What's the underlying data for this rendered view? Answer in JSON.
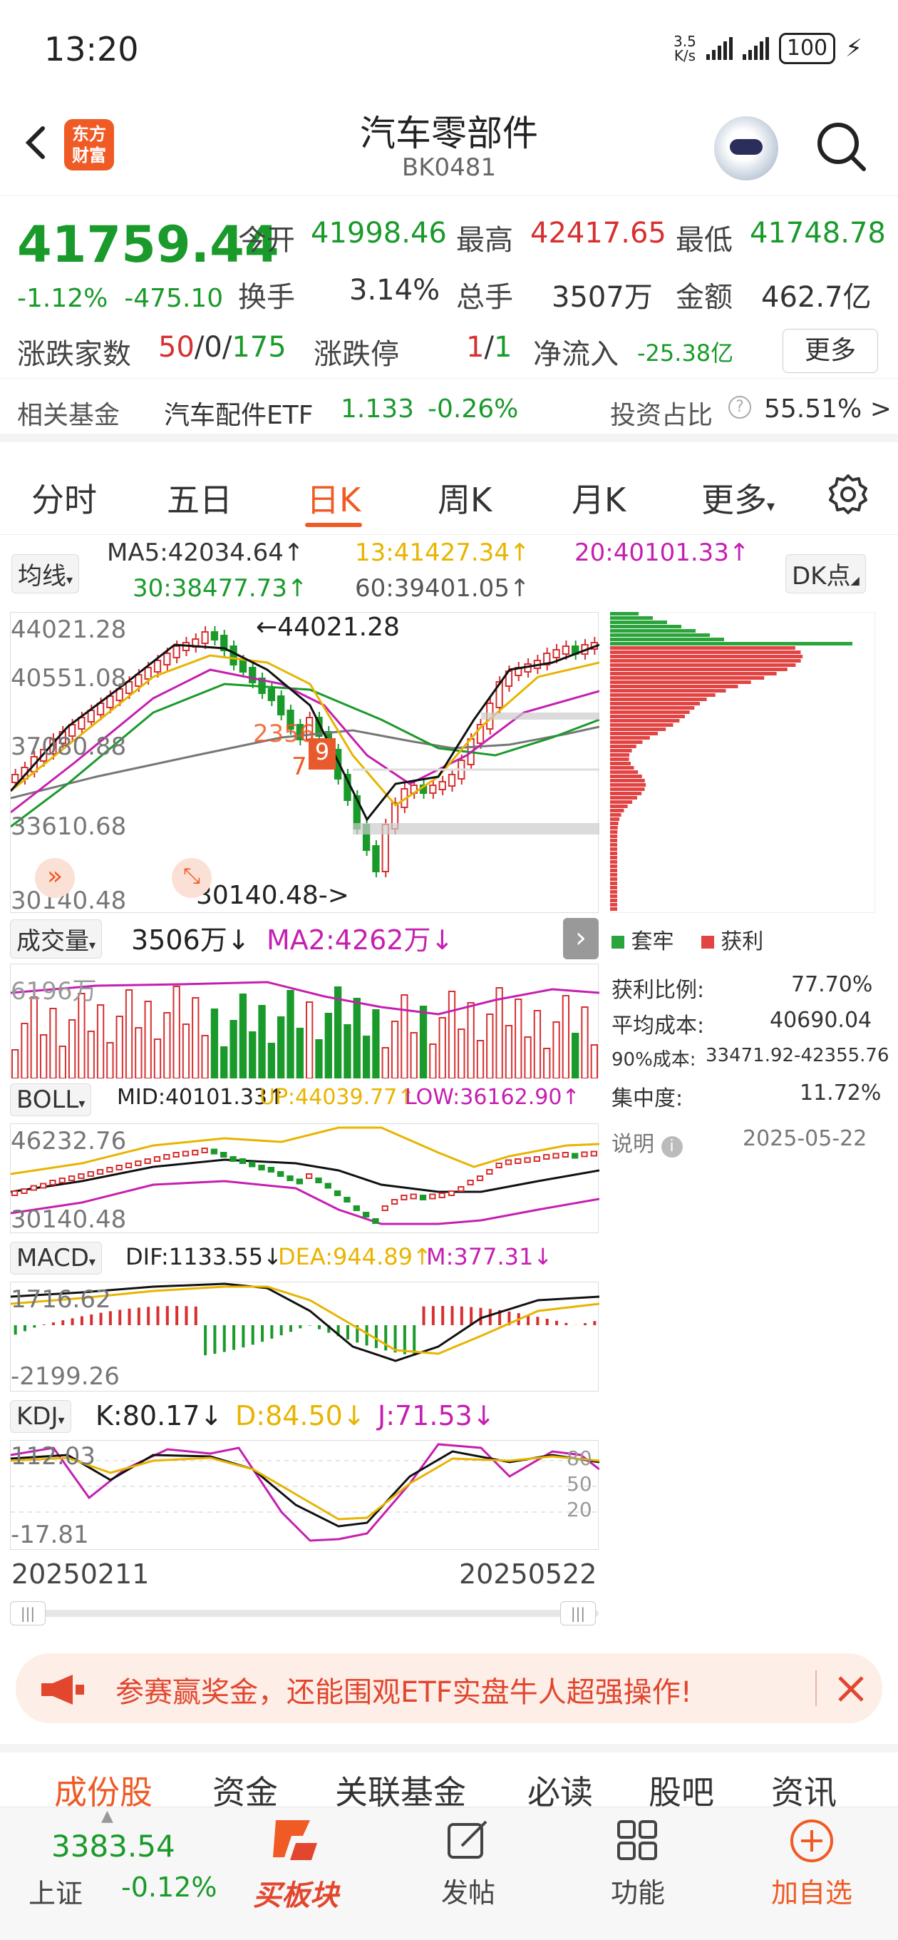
{
  "status_bar": {
    "time": "13:20",
    "net_speed_top": "3.5",
    "net_speed_bottom": "K/s",
    "battery": "100"
  },
  "header": {
    "logo_line1": "东方",
    "logo_line2": "财富",
    "title": "汽车零部件",
    "code": "BK0481"
  },
  "quote": {
    "price": "41759.44",
    "change_pct": "-1.12%",
    "change": "-475.10",
    "open_label": "今开",
    "open": "41998.46",
    "high_label": "最高",
    "high": "42417.65",
    "low_label": "最低",
    "low": "41748.78",
    "turnover_label": "换手",
    "turnover": "3.14%",
    "volume_label": "总手",
    "volume": "3507万",
    "amount_label": "金额",
    "amount": "462.7亿",
    "updown_label": "涨跌家数",
    "up": "50",
    "flat": "0",
    "down": "175",
    "sep": "/",
    "limit_label": "涨跌停",
    "limit_up": "1",
    "limit_down": "1",
    "netflow_label": "净流入",
    "netflow": "-25.38亿",
    "more_label": "更多"
  },
  "fund_row": {
    "label": "相关基金",
    "fund_name": "汽车配件ETF",
    "fund_price": "1.133",
    "fund_change": "-0.26%",
    "ratio_label": "投资占比",
    "ratio_value": "55.51% >"
  },
  "tabs": {
    "t1": "分时",
    "t2": "五日",
    "t3": "日K",
    "t4": "周K",
    "t5": "月K",
    "t6": "更多",
    "active": "日K"
  },
  "chart": {
    "ma_dropdown": "均线",
    "ma5": "MA5:42034.64↑",
    "ma13": "13:41427.34↑",
    "ma20": "20:40101.33↑",
    "ma30": "30:38477.73↑",
    "ma60": "60:39401.05↑",
    "dk_button": "DK点",
    "y_ticks": [
      "44021.28",
      "40551.08",
      "37080.88",
      "33610.68",
      "30140.48"
    ],
    "max_label": "←44021.28",
    "min_label": "30140.48->",
    "vol_dropdown": "成交量",
    "vol_value": "3506万↓",
    "vol_ma2": "MA2:4262万↓",
    "vol_tick": "6196万",
    "boll_dropdown": "BOLL",
    "boll_mid": "MID:40101.33↑",
    "boll_up": "UP:44039.77↑",
    "boll_low": "LOW:36162.90↑",
    "boll_ticks": [
      "46232.76",
      "30140.48"
    ],
    "macd_dropdown": "MACD",
    "macd_dif": "DIF:1133.55↓",
    "macd_dea": "DEA:944.89↑",
    "macd_m": "M:377.31↓",
    "macd_ticks": [
      "1716.62",
      "-2199.26"
    ],
    "kdj_dropdown": "KDJ",
    "kdj_k": "K:80.17↓",
    "kdj_d": "D:84.50↓",
    "kdj_j": "J:71.53↓",
    "kdj_ticks": [
      "112.03",
      "-17.81"
    ],
    "kdj_levels": [
      "80",
      "50",
      "20"
    ],
    "date_start": "20250211",
    "date_end": "20250522",
    "signal_labels": [
      "2",
      "3",
      "5",
      "6",
      "7",
      "9"
    ]
  },
  "chip_panel": {
    "legend_trapped": "套牢",
    "legend_profit": "获利",
    "profit_ratio_label": "获利比例:",
    "profit_ratio": "77.70%",
    "avg_cost_label": "平均成本:",
    "avg_cost": "40690.04",
    "cost90_label": "90%成本:",
    "cost90": "33471.92-42355.76",
    "concentration_label": "集中度:",
    "concentration": "11.72%",
    "note_label": "说明",
    "date": "2025-05-22"
  },
  "banner": {
    "text": "参赛赢奖金，还能围观ETF实盘牛人超强操作!"
  },
  "bottom_tabs": {
    "b1": "成份股",
    "b2": "资金",
    "b3": "关联基金",
    "b4": "必读",
    "b5": "股吧",
    "b6": "资讯"
  },
  "bottom_bar": {
    "index_value": "3383.54",
    "index_name": "上证",
    "index_change": "-0.12%",
    "buy_label": "买板块",
    "post_label": "发帖",
    "func_label": "功能",
    "add_label": "加自选"
  },
  "colors": {
    "up": "#d63031",
    "down": "#1a9a2b",
    "accent": "#f05a24",
    "ma13": "#e8b400",
    "ma20": "#c51fb0",
    "ma60": "#555555"
  }
}
